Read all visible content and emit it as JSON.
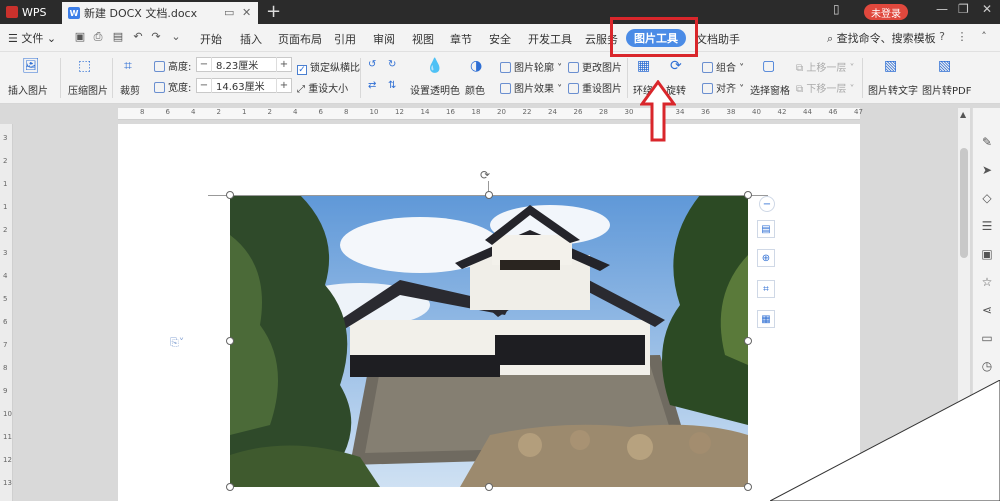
{
  "titlebar": {
    "app_name": "WPS",
    "doc_tab_badge": "W",
    "doc_title": "新建 DOCX 文档.docx",
    "login_label": "未登录"
  },
  "menu": {
    "file_label": "文件",
    "items": [
      "开始",
      "插入",
      "页面布局",
      "引用",
      "审阅",
      "视图",
      "章节",
      "安全",
      "开发工具",
      "云服务",
      "图片工具",
      "文档助手"
    ],
    "active": "图片工具",
    "search_label": "查找命令、搜索模板"
  },
  "ribbon": {
    "insert_picture": "插入图片",
    "compress_picture": "压缩图片",
    "crop": "裁剪",
    "height_label": "高度:",
    "height_value": "8.23厘米",
    "width_label": "宽度:",
    "width_value": "14.63厘米",
    "lock_ratio": "锁定纵横比",
    "reset_size": "重设大小",
    "set_transparent": "设置透明色",
    "color": "颜色",
    "picture_outline": "图片轮廓",
    "picture_effect": "图片效果",
    "change_picture": "更改图片",
    "reset_picture": "重设图片",
    "wrap": "环绕",
    "rotate": "旋转",
    "group": "组合",
    "align": "对齐",
    "move_up": "上移一层",
    "move_down": "下移一层",
    "selection_pane": "选择窗格",
    "pic_to_text": "图片转文字",
    "pic_to_pdf": "图片转PDF"
  },
  "ruler": {
    "top_numbers": [
      "8",
      "6",
      "4",
      "2",
      "1",
      "2",
      "4",
      "6",
      "8",
      "10",
      "12",
      "14",
      "16",
      "18",
      "20",
      "22",
      "24",
      "26",
      "28",
      "30",
      "32",
      "34",
      "36",
      "38",
      "40",
      "42",
      "44",
      "46",
      "47"
    ],
    "left_numbers": [
      "3",
      "2",
      "1",
      "1",
      "2",
      "3",
      "4",
      "5",
      "6",
      "7",
      "8",
      "9",
      "10",
      "11",
      "12",
      "13"
    ]
  },
  "colors": {
    "accent": "#4a8be6",
    "annotation": "#d9262b",
    "login": "#e0483d"
  }
}
